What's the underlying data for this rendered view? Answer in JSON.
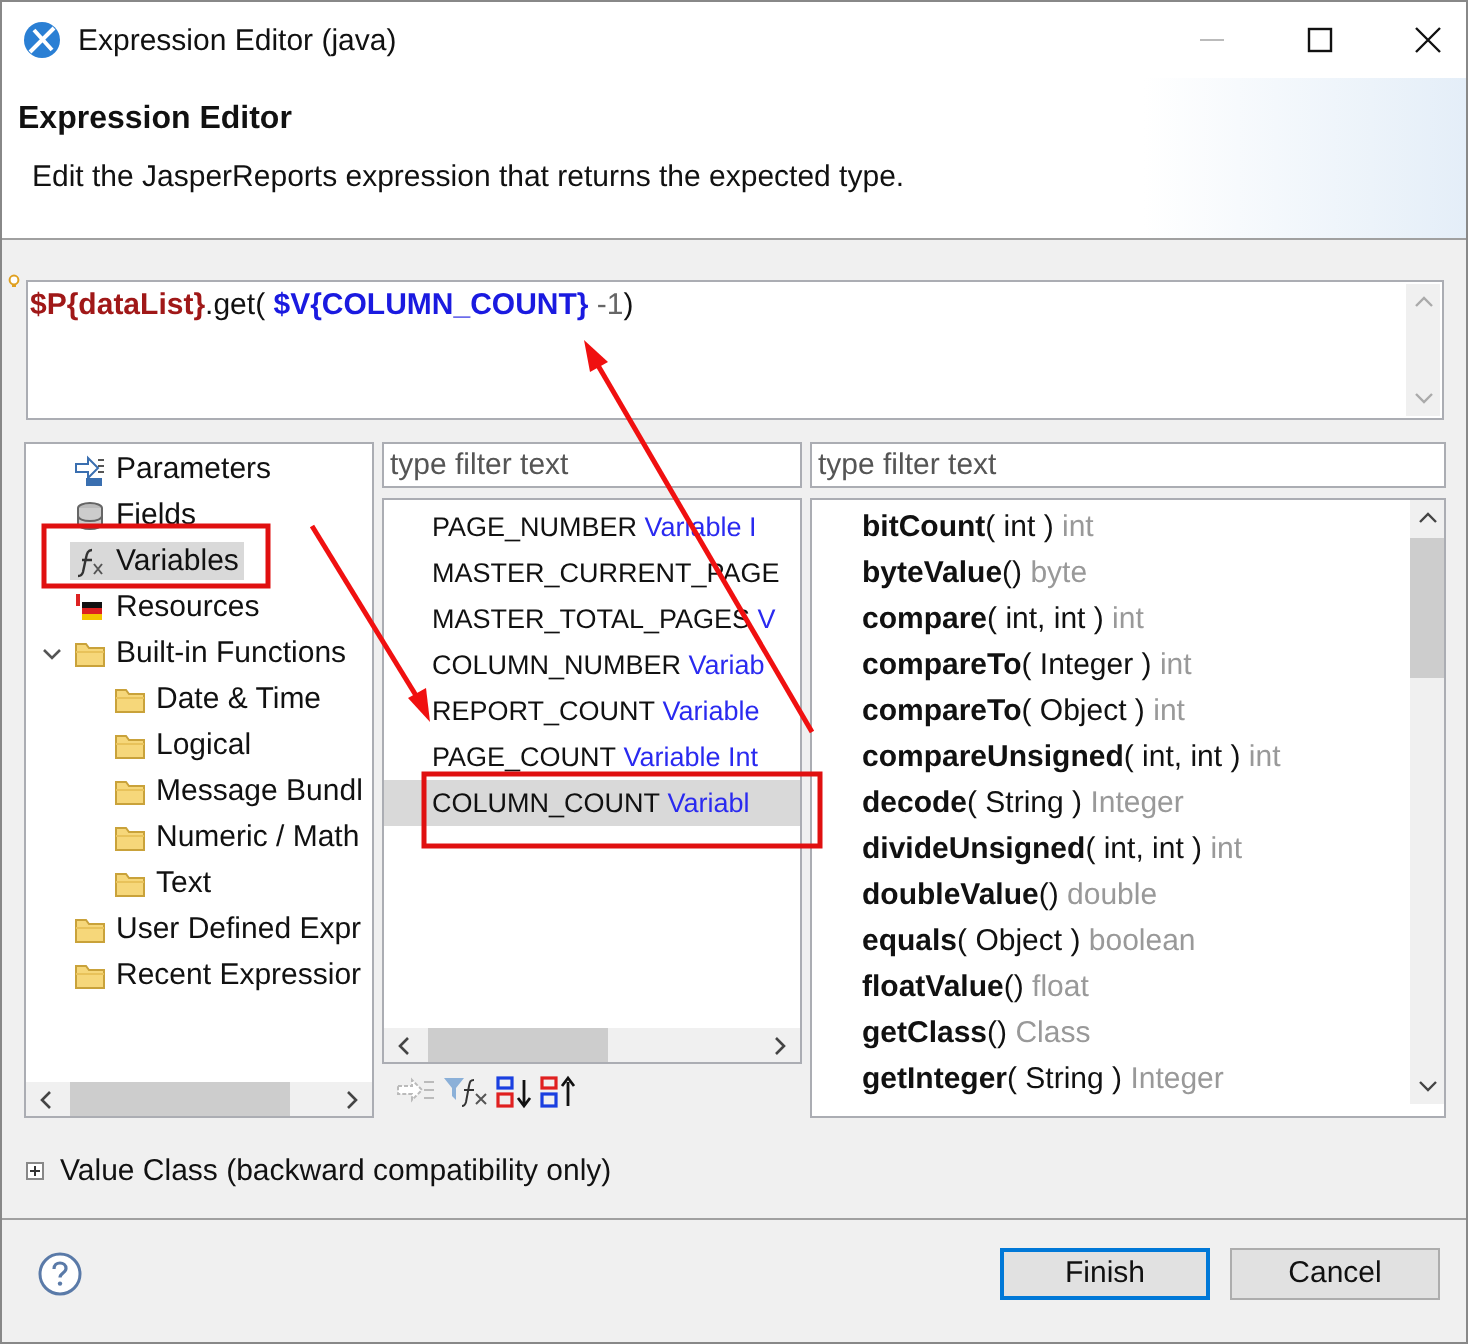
{
  "window": {
    "title": "Expression Editor (java)"
  },
  "header": {
    "title": "Expression Editor",
    "description": "Edit the JasperReports expression that returns the expected type."
  },
  "expression": [
    {
      "kind": "parameter",
      "text": "$P{dataList}"
    },
    {
      "kind": "plain",
      "text": ".get( "
    },
    {
      "kind": "variable",
      "text": "$V{COLUMN_COUNT}"
    },
    {
      "kind": "number",
      "text": " -1"
    },
    {
      "kind": "plain",
      "text": ")"
    }
  ],
  "categories": [
    {
      "label": "Parameters",
      "kind": "parameters",
      "selected": false
    },
    {
      "label": "Fields",
      "kind": "fields",
      "selected": false
    },
    {
      "label": "Variables",
      "kind": "variables",
      "selected": true
    },
    {
      "label": "Resources",
      "kind": "resources",
      "selected": false
    },
    {
      "label": "Built-in Functions",
      "kind": "folder",
      "selected": false,
      "expanded": true,
      "children": [
        {
          "label": "Date & Time",
          "kind": "folder",
          "selected": false
        },
        {
          "label": "Logical",
          "kind": "folder",
          "selected": false
        },
        {
          "label": "Message Bundl",
          "kind": "folder",
          "selected": false
        },
        {
          "label": "Numeric / Math",
          "kind": "folder",
          "selected": false
        },
        {
          "label": "Text",
          "kind": "folder",
          "selected": false
        }
      ]
    },
    {
      "label": "User Defined Expr",
      "kind": "folder",
      "selected": false
    },
    {
      "label": "Recent Expressior",
      "kind": "folder",
      "selected": false
    }
  ],
  "variables_filter": {
    "placeholder": "type filter text"
  },
  "variables": [
    {
      "name": "PAGE_NUMBER",
      "type": "Variable I",
      "selected": false
    },
    {
      "name": "MASTER_CURRENT_PAGE",
      "selected": false
    },
    {
      "name": "MASTER_TOTAL_PAGES",
      "type": "V",
      "selected": false
    },
    {
      "name": "COLUMN_NUMBER",
      "type": "Variab",
      "selected": false
    },
    {
      "name": "REPORT_COUNT",
      "type": "Variable",
      "selected": false
    },
    {
      "name": "PAGE_COUNT",
      "type": "Variable Int",
      "selected": false
    },
    {
      "name": "COLUMN_COUNT",
      "type": "Variabl",
      "selected": true
    }
  ],
  "functions_filter": {
    "placeholder": "type filter text"
  },
  "functions": [
    {
      "name": "bitCount",
      "params": "( int )",
      "returns": "int"
    },
    {
      "name": "byteValue",
      "params": "()",
      "returns": "byte"
    },
    {
      "name": "compare",
      "params": "( int, int )",
      "returns": "int"
    },
    {
      "name": "compareTo",
      "params": "( Integer )",
      "returns": "int"
    },
    {
      "name": "compareTo",
      "params": "( Object )",
      "returns": "int"
    },
    {
      "name": "compareUnsigned",
      "params": "( int, int )",
      "returns": "int"
    },
    {
      "name": "decode",
      "params": "( String )",
      "returns": "Integer"
    },
    {
      "name": "divideUnsigned",
      "params": "( int, int )",
      "returns": "int"
    },
    {
      "name": "doubleValue",
      "params": "()",
      "returns": "double"
    },
    {
      "name": "equals",
      "params": "( Object )",
      "returns": "boolean"
    },
    {
      "name": "floatValue",
      "params": "()",
      "returns": "float"
    },
    {
      "name": "getClass",
      "params": "()",
      "returns": "Class"
    },
    {
      "name": "getInteger",
      "params": "( String )",
      "returns": "Integer"
    }
  ],
  "value_class": {
    "label": "Value Class (backward compatibility only)",
    "expanded": false
  },
  "buttons": [
    {
      "label": "Finish",
      "default": true
    },
    {
      "label": "Cancel",
      "default": false
    }
  ]
}
